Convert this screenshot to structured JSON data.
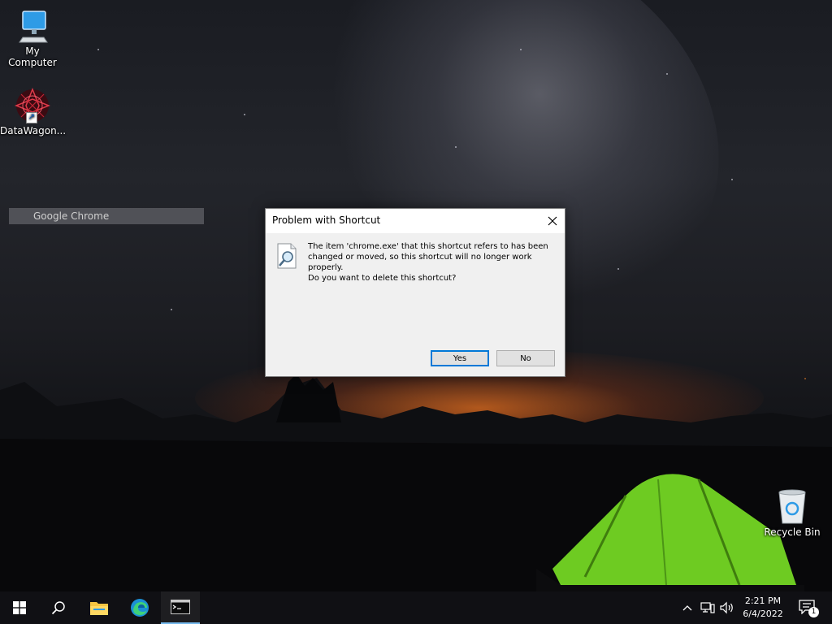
{
  "desktop": {
    "icons": [
      {
        "label": "My Computer",
        "icon": "computer-icon"
      },
      {
        "label": "DataWagon...",
        "icon": "datawagon-icon"
      },
      {
        "label": "Recycle Bin",
        "icon": "recycle-bin-icon"
      }
    ],
    "ghost_label": "Google Chrome"
  },
  "dialog": {
    "title": "Problem with Shortcut",
    "message": "The item 'chrome.exe' that this shortcut refers to has been changed or moved, so this shortcut will no longer work properly.",
    "question": "Do you want to delete this shortcut?",
    "yes_label": "Yes",
    "no_label": "No",
    "icon": "search-document-icon"
  },
  "taskbar": {
    "items": [
      "start-icon",
      "search-icon",
      "file-explorer-icon",
      "edge-icon",
      "terminal-icon"
    ],
    "active_item": "terminal-icon",
    "time": "2:21 PM",
    "date": "6/4/2022",
    "notification_count": "1"
  },
  "colors": {
    "accent": "#0078d7",
    "taskbar_bg": "#101014",
    "dialog_bg": "#f0f0f0",
    "tent_green": "#7bd62a"
  }
}
